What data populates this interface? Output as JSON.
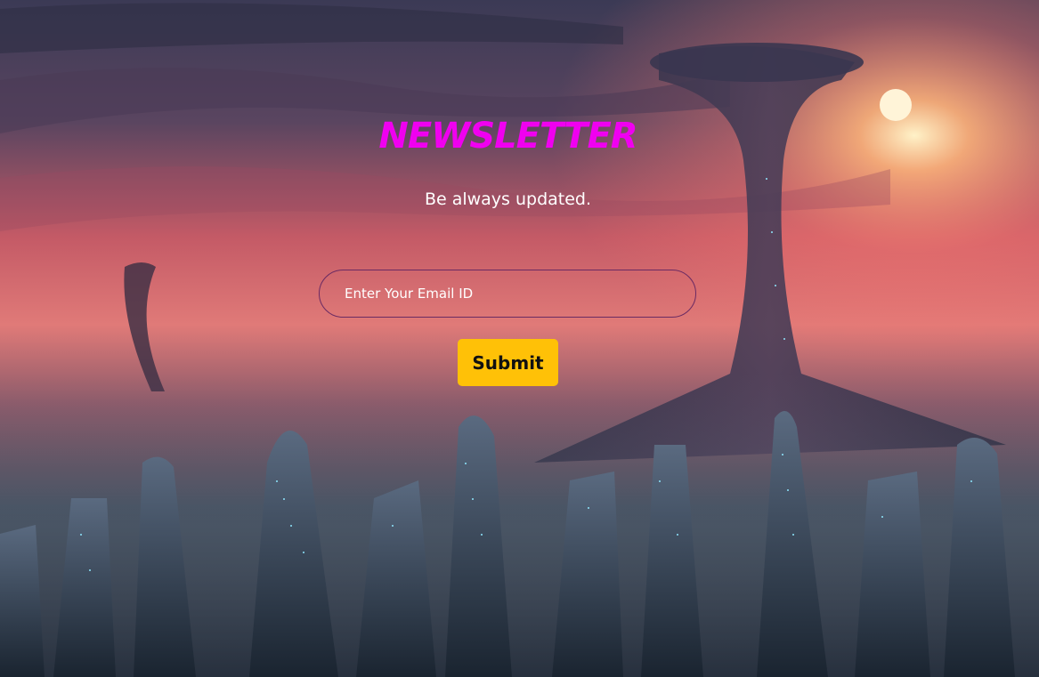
{
  "newsletter": {
    "title": "NEWSLETTER",
    "subtitle": "Be always updated.",
    "email_placeholder": "Enter Your Email ID",
    "email_value": "",
    "submit_label": "Submit"
  },
  "colors": {
    "title": "#f000f0",
    "button": "#ffc107",
    "input_border": "#6a2a63"
  },
  "background": {
    "scene": "futuristic-city-sunset"
  }
}
